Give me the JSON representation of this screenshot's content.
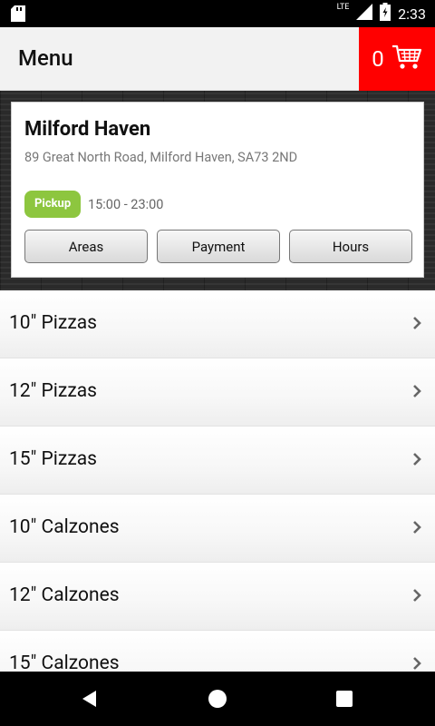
{
  "status_bar": {
    "time": "2:33",
    "network": "LTE"
  },
  "app_bar": {
    "title": "Menu",
    "cart_count": "0"
  },
  "store": {
    "name": "Milford Haven",
    "address": "89 Great North Road, Milford Haven, SA73 2ND",
    "badge": "Pickup",
    "hours": "15:00 - 23:00",
    "buttons": {
      "areas": "Areas",
      "payment": "Payment",
      "hours": "Hours"
    }
  },
  "menu": {
    "items": [
      {
        "label": "10\" Pizzas"
      },
      {
        "label": "12\" Pizzas"
      },
      {
        "label": "15\" Pizzas"
      },
      {
        "label": "10\" Calzones"
      },
      {
        "label": "12\" Calzones"
      },
      {
        "label": "15\" Calzones"
      }
    ]
  },
  "colors": {
    "cart_bg": "#ff0000",
    "badge_bg": "#8dc63f"
  }
}
